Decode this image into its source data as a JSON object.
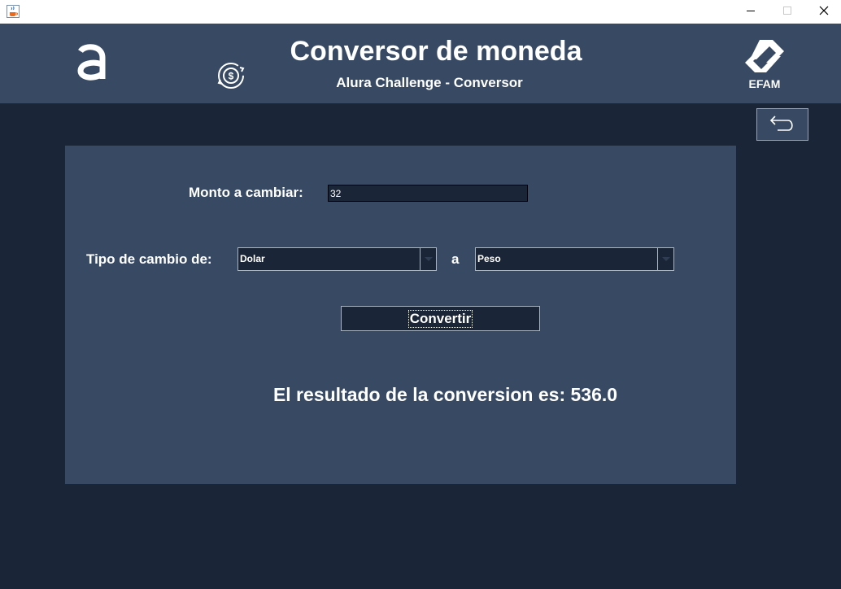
{
  "window": {
    "icons": {
      "app": "java-cup-icon",
      "minimize": "minimize-icon",
      "maximize": "maximize-icon",
      "close": "close-icon"
    }
  },
  "header": {
    "title": "Conversor de moneda",
    "subtitle": "Alura Challenge - Conversor",
    "left_logo_letter": "a",
    "right_logo_text": "EFAM",
    "icons": {
      "currency": "currency-exchange-icon",
      "back": "back-arrow-icon"
    }
  },
  "form": {
    "amount_label": "Monto a cambiar:",
    "amount_value": "32",
    "from_label": "Tipo de cambio de:",
    "from_value": "Dolar",
    "to_label": "a",
    "to_value": "Peso",
    "convert_label": "Convertir",
    "result_text": "El resultado de la conversion es: 536.0"
  },
  "colors": {
    "background": "#1a2638",
    "panel": "#384a63",
    "text": "#ffffff"
  }
}
